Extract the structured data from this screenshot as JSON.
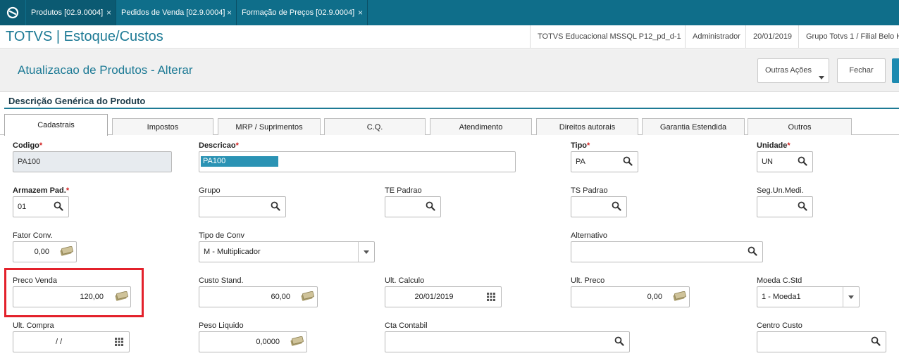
{
  "window_tabs": [
    {
      "label": "Produtos [02.9.0004]",
      "close": "×"
    },
    {
      "label": "Pedidos de Venda [02.9.0004]",
      "close": "×"
    },
    {
      "label": "Formação de Preços [02.9.0004]",
      "close": "×"
    }
  ],
  "header": {
    "app_title": "TOTVS | Estoque/Custos",
    "environment": "TOTVS Educacional MSSQL P12_pd_d-1",
    "user": "Administrador",
    "date": "20/01/2019",
    "branch": "Grupo Totvs 1 / Filial Belo H"
  },
  "page": {
    "title": "Atualizacao de Produtos - Alterar",
    "more_actions_label": "Outras Ações",
    "close_label": "Fechar"
  },
  "section": {
    "title": "Descrição Genérica do Produto"
  },
  "folder_tabs": [
    "Cadastrais",
    "Impostos",
    "MRP / Suprimentos",
    "C.Q.",
    "Atendimento",
    "Direitos autorais",
    "Garantia Estendida",
    "Outros"
  ],
  "required_marker": "*",
  "fields": {
    "codigo": {
      "label": "Codigo",
      "value": "PA100"
    },
    "descricao": {
      "label": "Descricao",
      "value": "PA100"
    },
    "tipo": {
      "label": "Tipo",
      "value": "PA"
    },
    "unidade": {
      "label": "Unidade",
      "value": "UN"
    },
    "armazem": {
      "label": "Armazem Pad.",
      "value": "01"
    },
    "grupo": {
      "label": "Grupo",
      "value": ""
    },
    "te_padrao": {
      "label": "TE Padrao",
      "value": ""
    },
    "ts_padrao": {
      "label": "TS Padrao",
      "value": ""
    },
    "seg_un": {
      "label": "Seg.Un.Medi.",
      "value": ""
    },
    "fator_conv": {
      "label": "Fator Conv.",
      "value": "0,00"
    },
    "tipo_conv": {
      "label": "Tipo de Conv",
      "value": "M - Multiplicador"
    },
    "alternativo": {
      "label": "Alternativo",
      "value": ""
    },
    "preco_venda": {
      "label": "Preco Venda",
      "value": "120,00"
    },
    "custo_stand": {
      "label": "Custo Stand.",
      "value": "60,00"
    },
    "ult_calculo": {
      "label": "Ult. Calculo",
      "value": "20/01/2019"
    },
    "ult_preco": {
      "label": "Ult. Preco",
      "value": "0,00"
    },
    "moeda": {
      "label": "Moeda C.Std",
      "value": "1 - Moeda1"
    },
    "ult_compra": {
      "label": "Ult. Compra",
      "value": "/ /"
    },
    "peso_liquido": {
      "label": "Peso Liquido",
      "value": "0,0000"
    },
    "cta_contabil": {
      "label": "Cta Contabil",
      "value": ""
    },
    "centro_custo": {
      "label": "Centro Custo",
      "value": ""
    }
  },
  "colors": {
    "accent": "#1d7a95",
    "topbar": "#0f6e8a",
    "required": "#d21f1f",
    "highlight": "#e3212b"
  }
}
